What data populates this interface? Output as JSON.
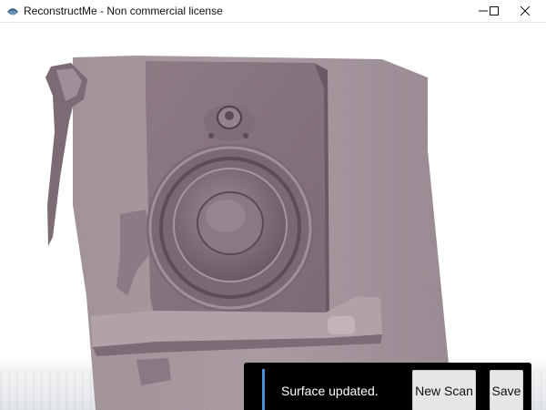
{
  "window": {
    "title": "ReconstructMe - Non commercial license",
    "icons": [
      "app-logo-icon",
      "minimize-icon",
      "maximize-icon",
      "close-icon"
    ]
  },
  "viewport": {
    "content": "3d-surface-reconstruction-speaker",
    "surface_color": "#8f7b85"
  },
  "toast": {
    "message": "Surface updated.",
    "new_scan_label": "New Scan",
    "save_label": "Save",
    "accent_color": "#4a90d9"
  }
}
